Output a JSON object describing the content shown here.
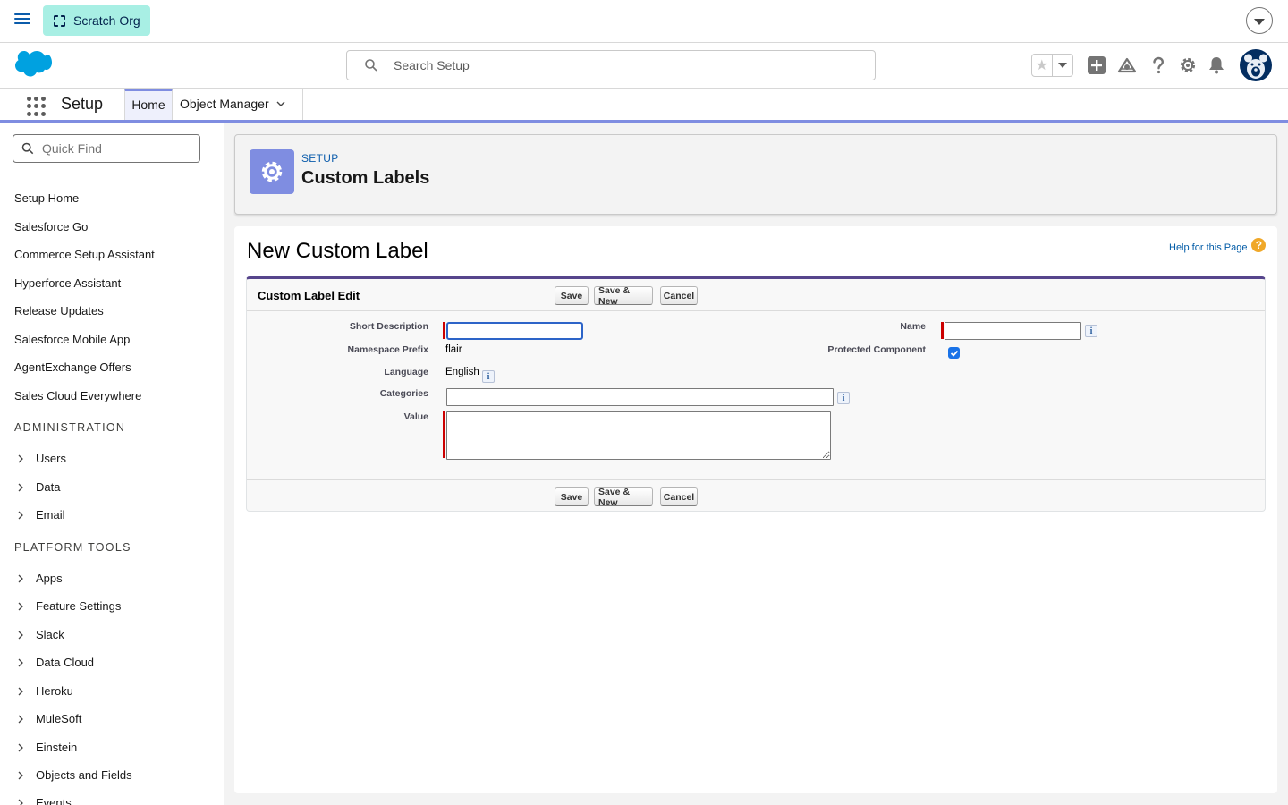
{
  "topbar": {
    "org_label": "Scratch Org"
  },
  "header": {
    "search_placeholder": "Search Setup",
    "icons": [
      "favorites-star-icon",
      "favorites-dropdown-icon",
      "global-actions-icon",
      "trailhead-guidance-icon",
      "help-icon",
      "setup-gear-icon",
      "notifications-bell-icon",
      "user-avatar"
    ]
  },
  "nav": {
    "app_name": "Setup",
    "tabs": [
      {
        "label": "Home",
        "active": true
      },
      {
        "label": "Object Manager",
        "active": false
      }
    ]
  },
  "sidebar": {
    "quick_find_placeholder": "Quick Find",
    "links": [
      "Setup Home",
      "Salesforce Go",
      "Commerce Setup Assistant",
      "Hyperforce Assistant",
      "Release Updates",
      "Salesforce Mobile App",
      "AgentExchange Offers",
      "Sales Cloud Everywhere"
    ],
    "sections": [
      {
        "heading": "ADMINISTRATION",
        "items": [
          "Users",
          "Data",
          "Email"
        ]
      },
      {
        "heading": "PLATFORM TOOLS",
        "items": [
          "Apps",
          "Feature Settings",
          "Slack",
          "Data Cloud",
          "Heroku",
          "MuleSoft",
          "Einstein",
          "Objects and Fields",
          "Events"
        ]
      }
    ]
  },
  "page_header": {
    "eyebrow": "SETUP",
    "title": "Custom Labels"
  },
  "page": {
    "title": "New Custom Label",
    "help_link": "Help for this Page"
  },
  "form": {
    "panel_title": "Custom Label Edit",
    "buttons": {
      "save": "Save",
      "save_new": "Save & New",
      "cancel": "Cancel"
    },
    "fields": {
      "short_description": {
        "label": "Short Description",
        "value": ""
      },
      "namespace_prefix": {
        "label": "Namespace Prefix",
        "value": "flair"
      },
      "language": {
        "label": "Language",
        "value": "English"
      },
      "categories": {
        "label": "Categories",
        "value": ""
      },
      "value": {
        "label": "Value",
        "value": ""
      },
      "name": {
        "label": "Name",
        "value": ""
      },
      "protected_component": {
        "label": "Protected Component",
        "checked": true
      }
    },
    "info_icon_glyph": "i"
  },
  "colors": {
    "accent": "#7f8de1",
    "link": "#0b5cab",
    "required": "#cc0000",
    "scratch_badge": "#a8efe4"
  }
}
